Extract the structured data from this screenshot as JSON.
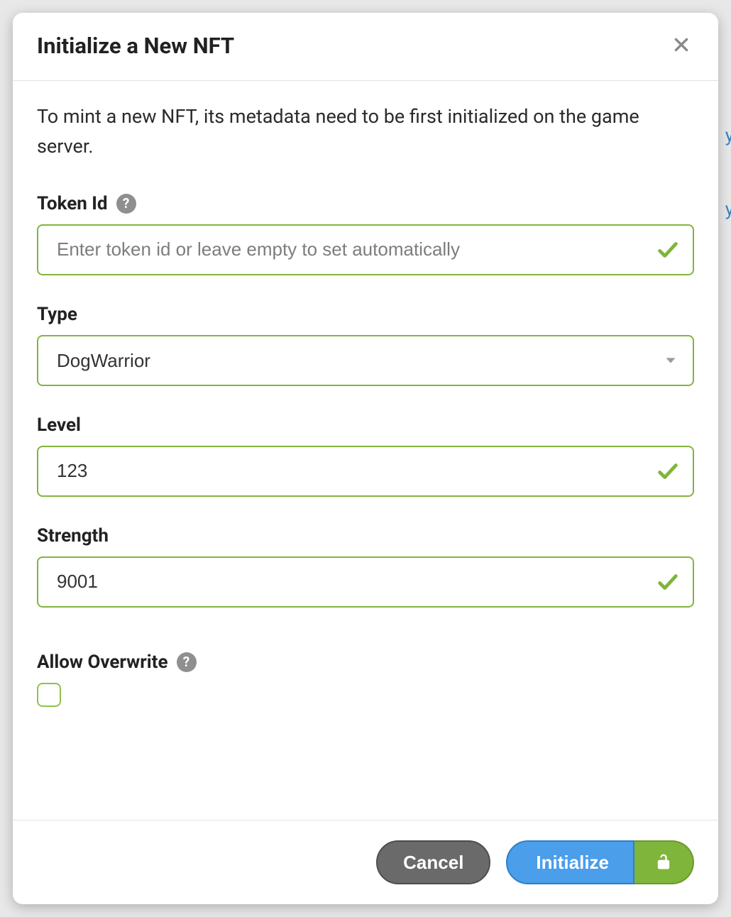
{
  "modal": {
    "title": "Initialize a New NFT",
    "intro": "To mint a new NFT, its metadata need to be first initialized on the game server."
  },
  "fields": {
    "tokenId": {
      "label": "Token Id",
      "placeholder": "Enter token id or leave empty to set automatically",
      "value": ""
    },
    "type": {
      "label": "Type",
      "selected": "DogWarrior"
    },
    "level": {
      "label": "Level",
      "value": "123"
    },
    "strength": {
      "label": "Strength",
      "value": "9001"
    },
    "allowOverwrite": {
      "label": "Allow Overwrite",
      "checked": false
    }
  },
  "footer": {
    "cancel": "Cancel",
    "initialize": "Initialize"
  },
  "colors": {
    "valid_border": "#83b43f",
    "primary_blue": "#4a9eea",
    "accent_green": "#7fb53a"
  }
}
